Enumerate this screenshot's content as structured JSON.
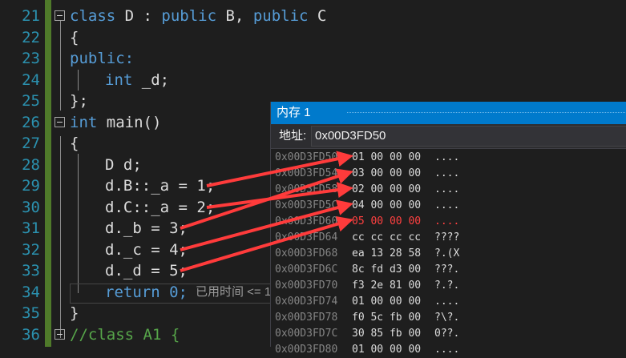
{
  "editor": {
    "lines": [
      {
        "num": "21",
        "text": "class D : public B, public C",
        "fold": true
      },
      {
        "num": "22",
        "text": "{"
      },
      {
        "num": "23",
        "text": "public:"
      },
      {
        "num": "24",
        "text": "int _d;"
      },
      {
        "num": "25",
        "text": "};"
      },
      {
        "num": "26",
        "text": "int main()",
        "fold": true
      },
      {
        "num": "27",
        "text": "{"
      },
      {
        "num": "28",
        "text": "D d;"
      },
      {
        "num": "29",
        "text": "d.B::_a = 1;"
      },
      {
        "num": "30",
        "text": "d.C::_a = 2;"
      },
      {
        "num": "31",
        "text": "d._b = 3;"
      },
      {
        "num": "32",
        "text": "d._c = 4;"
      },
      {
        "num": "33",
        "text": "d._d = 5;"
      },
      {
        "num": "34",
        "text": "return 0;"
      },
      {
        "num": "35",
        "text": "}"
      },
      {
        "num": "36",
        "text": "//class A1 {",
        "fold": true
      }
    ],
    "elapsed_hint": "已用时间 <= 1"
  },
  "memory": {
    "title": "内存 1",
    "address_label": "地址:",
    "address_value": "0x00D3FD50",
    "rows": [
      {
        "addr": "0x00D3FD50",
        "bytes": "01 00 00 00",
        "chars": "...."
      },
      {
        "addr": "0x00D3FD54",
        "bytes": "03 00 00 00",
        "chars": "...."
      },
      {
        "addr": "0x00D3FD58",
        "bytes": "02 00 00 00",
        "chars": "...."
      },
      {
        "addr": "0x00D3FD5C",
        "bytes": "04 00 00 00",
        "chars": "...."
      },
      {
        "addr": "0x00D3FD60",
        "bytes": "05 00 00 00",
        "chars": "....",
        "changed": true
      },
      {
        "addr": "0x00D3FD64",
        "bytes": "cc cc cc cc",
        "chars": "????"
      },
      {
        "addr": "0x00D3FD68",
        "bytes": "ea 13 28 58",
        "chars": "?.(X"
      },
      {
        "addr": "0x00D3FD6C",
        "bytes": "8c fd d3 00",
        "chars": "???."
      },
      {
        "addr": "0x00D3FD70",
        "bytes": "f3 2e 81 00",
        "chars": "?.?."
      },
      {
        "addr": "0x00D3FD74",
        "bytes": "01 00 00 00",
        "chars": "...."
      },
      {
        "addr": "0x00D3FD78",
        "bytes": "f0 5c fb 00",
        "chars": "?\\?."
      },
      {
        "addr": "0x00D3FD7C",
        "bytes": "30 85 fb 00",
        "chars": "0??."
      },
      {
        "addr": "0x00D3FD80",
        "bytes": "01 00 00 00",
        "chars": "...."
      }
    ]
  },
  "colors": {
    "keyword": "#569cd6",
    "line_number": "#2b91af",
    "title_bar": "#007acc",
    "arrow": "#ff3b3b",
    "changed_value": "#ff4040"
  }
}
